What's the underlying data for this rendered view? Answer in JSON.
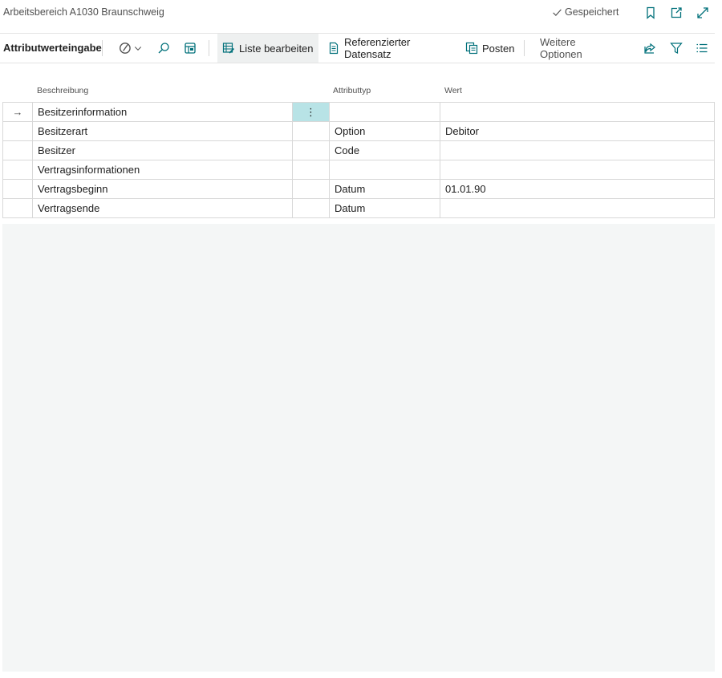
{
  "window": {
    "title": "Arbeitsbereich A1030 Braunschweig",
    "status": "Gespeichert",
    "icons": [
      "check-icon",
      "bookmark-icon",
      "open-new-window-icon",
      "expand-icon"
    ]
  },
  "actionbar": {
    "caption": "Attributwerteingabe",
    "edit_list_label": "Liste bearbeiten",
    "referenced_record_label": "Referenzierter Datensatz",
    "entries_label": "Posten",
    "more_options_label": "Weitere Optionen"
  },
  "grid": {
    "headers": [
      "Beschreibung",
      "Attributtyp",
      "Wert"
    ],
    "rows": [
      {
        "marker": "→",
        "description": "Besitzerinformation",
        "type": "",
        "value": ""
      },
      {
        "marker": "",
        "description": "Besitzerart",
        "type": "Option",
        "value": "Debitor"
      },
      {
        "marker": "",
        "description": "Besitzer",
        "type": "Code",
        "value": ""
      },
      {
        "marker": "",
        "description": "Vertragsinformationen",
        "type": "",
        "value": ""
      },
      {
        "marker": "",
        "description": "Vertragsbeginn",
        "type": "Datum",
        "value": "01.01.90"
      },
      {
        "marker": "",
        "description": "Vertragsende",
        "type": "Datum",
        "value": ""
      }
    ],
    "row_menu_glyph": "⋮"
  },
  "colors": {
    "accent": "#00707a",
    "active_cell": "#b8e3e6",
    "empty_area": "#f4f6f6"
  }
}
